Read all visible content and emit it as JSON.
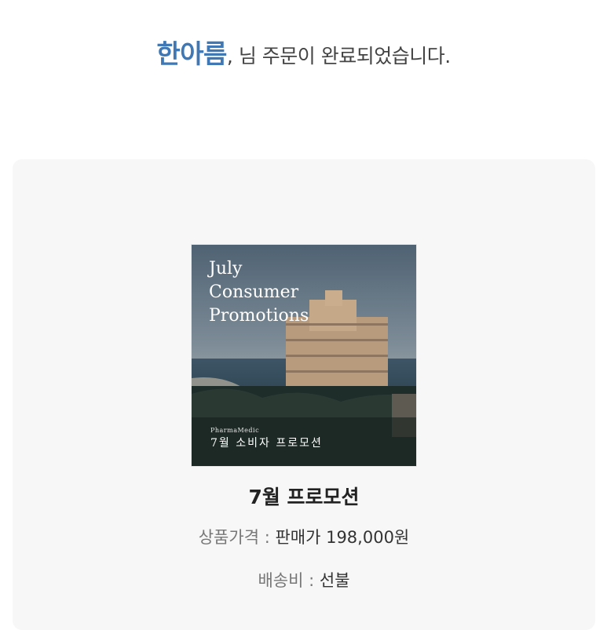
{
  "header": {
    "customer_name": "한아름",
    "message": ", 님 주문이 완료되었습니다."
  },
  "product": {
    "image": {
      "title_lines": [
        "July",
        "Consumer",
        "Promotions"
      ],
      "small_caption": "PharmaMedic",
      "korean_caption": "7월 소비자 프로모션"
    },
    "name": "7월 프로모션",
    "price_label": "상품가격 : ",
    "price_value": "판매가 198,000원",
    "shipping_label": "배송비 : ",
    "shipping_value": "선불"
  },
  "colors": {
    "accent": "#3f78b4",
    "card_bg": "#f7f7f7"
  }
}
